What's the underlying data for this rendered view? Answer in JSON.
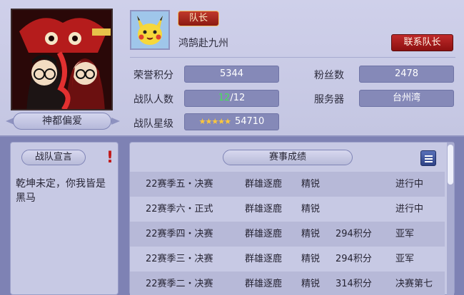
{
  "team": {
    "name": "神都偏爱",
    "logo_icon": "team-logo-art"
  },
  "leader": {
    "badge": "队长",
    "name": "鸿鹄赴九州",
    "contact_label": "联系队长",
    "avatar_icon": "pikachu-avatar"
  },
  "stats": {
    "honor_label": "荣誉积分",
    "honor_value": "5344",
    "fans_label": "粉丝数",
    "fans_value": "2478",
    "members_label": "战队人数",
    "members_current": "12",
    "members_max": "/12",
    "server_label": "服务器",
    "server_value": "台州湾",
    "stars_label": "战队星级",
    "stars_glyphs": "★★★★★",
    "stars_value": "54710"
  },
  "motto": {
    "title": "战队宣言",
    "text": "乾坤未定，你我皆是黑马"
  },
  "results": {
    "title": "赛事成绩",
    "rows": [
      {
        "season": "22赛季五・决赛",
        "mode": "群雄逐鹿",
        "tier": "精锐",
        "points": "",
        "status": "进行中"
      },
      {
        "season": "22赛季六・正式",
        "mode": "群雄逐鹿",
        "tier": "精锐",
        "points": "",
        "status": "进行中"
      },
      {
        "season": "22赛季四・决赛",
        "mode": "群雄逐鹿",
        "tier": "精锐",
        "points": "294积分",
        "status": "亚军"
      },
      {
        "season": "22赛季三・决赛",
        "mode": "群雄逐鹿",
        "tier": "精锐",
        "points": "294积分",
        "status": "亚军"
      },
      {
        "season": "22赛季二・决赛",
        "mode": "群雄逐鹿",
        "tier": "精锐",
        "points": "314积分",
        "status": "决赛第七"
      }
    ]
  },
  "colors": {
    "background": "#7e82b4",
    "panel": "#c7c9e4",
    "value_box": "#8589b8",
    "accent_red": "#b01f1f",
    "member_highlight": "#46e05a",
    "star_gold": "#ffc83a"
  }
}
